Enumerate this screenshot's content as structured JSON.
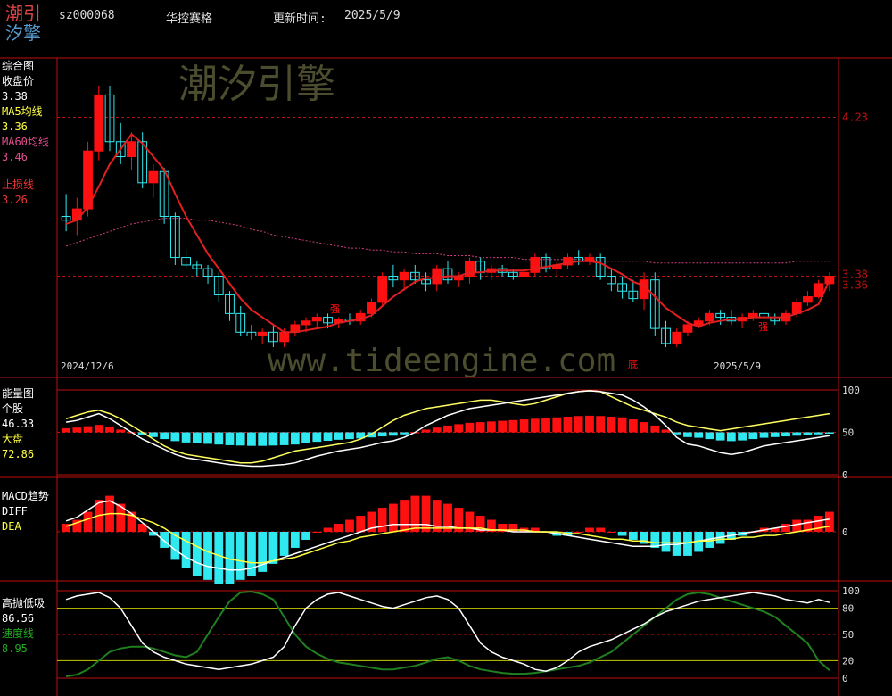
{
  "header": {
    "logo_top": "潮引",
    "logo_bottom": "汐擎",
    "code": "sz000068",
    "name": "华控赛格",
    "update_label": "更新时间:",
    "update_date": "2025/5/9"
  },
  "watermarks": {
    "brand": "潮汐引擎",
    "url": "www.tideengine.com"
  },
  "colors": {
    "up": "#ff1010",
    "down": "#30e8f0",
    "ma5": "#ffff40",
    "ma60": "#d04080",
    "stop": "#e02020",
    "frame": "#c01010",
    "energy_stock": "#ffffff",
    "energy_market": "#ffff60",
    "speed": "#208020"
  },
  "main_panel": {
    "title": "综合图",
    "close_label": "收盘价",
    "close_value": "3.38",
    "ma5_label": "MA5均线",
    "ma5_value": "3.36",
    "ma60_label": "MA60均线",
    "ma60_value": "3.46",
    "stop_label": "止损线",
    "stop_value": "3.26",
    "date_start": "2024/12/6",
    "date_end": "2025/5/9",
    "price_ticks": [
      "4.23",
      "3.38",
      "3.36"
    ],
    "annotations": [
      "强",
      "强",
      "底"
    ]
  },
  "energy_panel": {
    "title": "能量图",
    "stock_label": "个股",
    "stock_value": "46.33",
    "market_label": "大盘",
    "market_value": "72.86",
    "ticks": [
      "100",
      "50",
      "0"
    ]
  },
  "macd_panel": {
    "title": "MACD趋势",
    "diff_label": "DIFF",
    "dea_label": "DEA",
    "ticks": [
      "0"
    ]
  },
  "gaopao_panel": {
    "title": "高抛低吸",
    "value": "86.56",
    "speed_label": "速度线",
    "speed_value": "8.95",
    "ticks": [
      "100",
      "80",
      "50",
      "20",
      "0"
    ]
  },
  "chart_data": {
    "type": "line",
    "title": "华控赛格 sz000068",
    "x_start": "2024/12/6",
    "x_end": "2025/5/9",
    "candles_ohlc": [
      [
        3.7,
        3.82,
        3.62,
        3.68
      ],
      [
        3.68,
        3.8,
        3.6,
        3.74
      ],
      [
        3.74,
        4.1,
        3.7,
        4.05
      ],
      [
        4.05,
        4.4,
        4.0,
        4.35
      ],
      [
        4.35,
        4.4,
        4.05,
        4.1
      ],
      [
        4.1,
        4.2,
        3.98,
        4.02
      ],
      [
        4.02,
        4.15,
        3.95,
        4.1
      ],
      [
        4.1,
        4.15,
        3.85,
        3.88
      ],
      [
        3.88,
        3.98,
        3.8,
        3.94
      ],
      [
        3.94,
        3.96,
        3.66,
        3.7
      ],
      [
        3.7,
        3.72,
        3.44,
        3.48
      ],
      [
        3.48,
        3.52,
        3.42,
        3.44
      ],
      [
        3.44,
        3.46,
        3.38,
        3.42
      ],
      [
        3.42,
        3.44,
        3.34,
        3.38
      ],
      [
        3.38,
        3.4,
        3.24,
        3.28
      ],
      [
        3.28,
        3.3,
        3.14,
        3.18
      ],
      [
        3.18,
        3.22,
        3.06,
        3.08
      ],
      [
        3.08,
        3.12,
        3.04,
        3.06
      ],
      [
        3.06,
        3.1,
        3.02,
        3.08
      ],
      [
        3.08,
        3.12,
        3.0,
        3.03
      ],
      [
        3.03,
        3.1,
        3.0,
        3.08
      ],
      [
        3.08,
        3.14,
        3.06,
        3.12
      ],
      [
        3.12,
        3.16,
        3.08,
        3.14
      ],
      [
        3.14,
        3.18,
        3.1,
        3.16
      ],
      [
        3.16,
        3.18,
        3.1,
        3.13
      ],
      [
        3.13,
        3.16,
        3.1,
        3.15
      ],
      [
        3.15,
        3.18,
        3.12,
        3.14
      ],
      [
        3.14,
        3.2,
        3.12,
        3.18
      ],
      [
        3.18,
        3.26,
        3.16,
        3.24
      ],
      [
        3.24,
        3.4,
        3.22,
        3.38
      ],
      [
        3.38,
        3.44,
        3.32,
        3.36
      ],
      [
        3.36,
        3.42,
        3.3,
        3.4
      ],
      [
        3.4,
        3.44,
        3.34,
        3.36
      ],
      [
        3.36,
        3.4,
        3.3,
        3.34
      ],
      [
        3.34,
        3.44,
        3.3,
        3.42
      ],
      [
        3.42,
        3.46,
        3.34,
        3.36
      ],
      [
        3.36,
        3.4,
        3.32,
        3.38
      ],
      [
        3.38,
        3.48,
        3.34,
        3.46
      ],
      [
        3.46,
        3.48,
        3.36,
        3.4
      ],
      [
        3.4,
        3.44,
        3.36,
        3.42
      ],
      [
        3.42,
        3.44,
        3.38,
        3.4
      ],
      [
        3.4,
        3.42,
        3.36,
        3.38
      ],
      [
        3.38,
        3.42,
        3.36,
        3.4
      ],
      [
        3.4,
        3.5,
        3.38,
        3.48
      ],
      [
        3.48,
        3.5,
        3.4,
        3.42
      ],
      [
        3.42,
        3.46,
        3.38,
        3.44
      ],
      [
        3.44,
        3.5,
        3.42,
        3.48
      ],
      [
        3.48,
        3.52,
        3.44,
        3.46
      ],
      [
        3.46,
        3.5,
        3.44,
        3.48
      ],
      [
        3.48,
        3.5,
        3.36,
        3.38
      ],
      [
        3.38,
        3.42,
        3.3,
        3.34
      ],
      [
        3.34,
        3.38,
        3.26,
        3.3
      ],
      [
        3.3,
        3.36,
        3.24,
        3.26
      ],
      [
        3.26,
        3.4,
        3.2,
        3.36
      ],
      [
        3.36,
        3.4,
        3.06,
        3.1
      ],
      [
        3.1,
        3.14,
        3.0,
        3.02
      ],
      [
        3.02,
        3.1,
        3.0,
        3.08
      ],
      [
        3.08,
        3.14,
        3.06,
        3.12
      ],
      [
        3.12,
        3.16,
        3.1,
        3.14
      ],
      [
        3.14,
        3.2,
        3.12,
        3.18
      ],
      [
        3.18,
        3.2,
        3.12,
        3.16
      ],
      [
        3.16,
        3.2,
        3.12,
        3.14
      ],
      [
        3.14,
        3.18,
        3.1,
        3.16
      ],
      [
        3.16,
        3.2,
        3.14,
        3.18
      ],
      [
        3.18,
        3.2,
        3.14,
        3.16
      ],
      [
        3.16,
        3.18,
        3.12,
        3.14
      ],
      [
        3.14,
        3.2,
        3.12,
        3.18
      ],
      [
        3.18,
        3.26,
        3.16,
        3.24
      ],
      [
        3.24,
        3.3,
        3.22,
        3.27
      ],
      [
        3.27,
        3.36,
        3.26,
        3.34
      ],
      [
        3.34,
        3.4,
        3.3,
        3.38
      ]
    ],
    "ma5": [
      3.66,
      3.68,
      3.75,
      3.86,
      3.98,
      4.06,
      4.14,
      4.09,
      4.02,
      3.95,
      3.82,
      3.7,
      3.6,
      3.5,
      3.42,
      3.34,
      3.26,
      3.2,
      3.16,
      3.12,
      3.08,
      3.08,
      3.09,
      3.1,
      3.11,
      3.13,
      3.14,
      3.15,
      3.17,
      3.22,
      3.27,
      3.31,
      3.35,
      3.37,
      3.37,
      3.38,
      3.38,
      3.4,
      3.4,
      3.41,
      3.41,
      3.41,
      3.41,
      3.42,
      3.43,
      3.44,
      3.45,
      3.46,
      3.46,
      3.45,
      3.42,
      3.39,
      3.35,
      3.33,
      3.27,
      3.21,
      3.17,
      3.13,
      3.11,
      3.13,
      3.14,
      3.15,
      3.15,
      3.16,
      3.16,
      3.16,
      3.16,
      3.18,
      3.2,
      3.23,
      3.36
    ],
    "ma60": [
      3.54,
      3.56,
      3.58,
      3.6,
      3.62,
      3.64,
      3.66,
      3.67,
      3.68,
      3.69,
      3.69,
      3.69,
      3.68,
      3.68,
      3.67,
      3.66,
      3.65,
      3.63,
      3.62,
      3.6,
      3.59,
      3.58,
      3.57,
      3.56,
      3.55,
      3.54,
      3.53,
      3.53,
      3.52,
      3.52,
      3.51,
      3.51,
      3.5,
      3.5,
      3.5,
      3.49,
      3.49,
      3.49,
      3.48,
      3.48,
      3.48,
      3.48,
      3.47,
      3.47,
      3.47,
      3.47,
      3.47,
      3.47,
      3.47,
      3.46,
      3.46,
      3.46,
      3.46,
      3.46,
      3.45,
      3.45,
      3.45,
      3.45,
      3.45,
      3.45,
      3.45,
      3.45,
      3.45,
      3.45,
      3.45,
      3.45,
      3.45,
      3.46,
      3.46,
      3.46,
      3.46
    ],
    "energy_stock": [
      62,
      64,
      68,
      72,
      66,
      58,
      50,
      42,
      36,
      30,
      24,
      20,
      18,
      16,
      14,
      12,
      11,
      10,
      10,
      11,
      12,
      14,
      18,
      22,
      25,
      28,
      30,
      32,
      35,
      38,
      40,
      44,
      50,
      58,
      64,
      70,
      74,
      78,
      80,
      82,
      84,
      86,
      88,
      90,
      92,
      94,
      96,
      98,
      99,
      98,
      96,
      94,
      88,
      80,
      70,
      58,
      44,
      36,
      34,
      30,
      26,
      24,
      26,
      30,
      34,
      36,
      38,
      40,
      42,
      44,
      46
    ],
    "energy_market": [
      66,
      70,
      74,
      76,
      72,
      66,
      58,
      50,
      42,
      34,
      28,
      24,
      22,
      20,
      18,
      16,
      14,
      14,
      16,
      20,
      24,
      28,
      30,
      32,
      34,
      36,
      38,
      42,
      48,
      56,
      64,
      70,
      74,
      78,
      80,
      82,
      84,
      86,
      88,
      88,
      86,
      84,
      82,
      84,
      88,
      92,
      96,
      98,
      99,
      98,
      92,
      86,
      80,
      76,
      72,
      68,
      62,
      58,
      56,
      54,
      52,
      54,
      56,
      58,
      60,
      62,
      64,
      66,
      68,
      70,
      72
    ],
    "macd_hist": [
      0.02,
      0.03,
      0.05,
      0.08,
      0.09,
      0.07,
      0.05,
      0.02,
      -0.01,
      -0.04,
      -0.07,
      -0.09,
      -0.11,
      -0.12,
      -0.13,
      -0.13,
      -0.12,
      -0.11,
      -0.1,
      -0.08,
      -0.06,
      -0.04,
      -0.02,
      0.0,
      0.01,
      0.02,
      0.03,
      0.04,
      0.05,
      0.06,
      0.07,
      0.08,
      0.09,
      0.09,
      0.08,
      0.07,
      0.06,
      0.05,
      0.04,
      0.03,
      0.02,
      0.02,
      0.01,
      0.01,
      0.0,
      -0.01,
      -0.01,
      0.0,
      0.01,
      0.01,
      0.0,
      -0.01,
      -0.02,
      -0.03,
      -0.04,
      -0.05,
      -0.06,
      -0.06,
      -0.05,
      -0.04,
      -0.03,
      -0.02,
      -0.01,
      0.0,
      0.01,
      0.01,
      0.02,
      0.03,
      0.03,
      0.04,
      0.05
    ],
    "macd_diff": [
      0.06,
      0.08,
      0.12,
      0.16,
      0.17,
      0.14,
      0.1,
      0.05,
      0.0,
      -0.05,
      -0.1,
      -0.14,
      -0.17,
      -0.19,
      -0.2,
      -0.21,
      -0.21,
      -0.2,
      -0.18,
      -0.16,
      -0.14,
      -0.12,
      -0.1,
      -0.08,
      -0.06,
      -0.04,
      -0.02,
      0.0,
      0.02,
      0.03,
      0.04,
      0.04,
      0.04,
      0.04,
      0.03,
      0.03,
      0.02,
      0.02,
      0.01,
      0.01,
      0.01,
      0.0,
      0.0,
      0.0,
      0.0,
      -0.01,
      -0.02,
      -0.03,
      -0.04,
      -0.05,
      -0.06,
      -0.07,
      -0.08,
      -0.08,
      -0.08,
      -0.07,
      -0.07,
      -0.06,
      -0.05,
      -0.04,
      -0.03,
      -0.02,
      -0.01,
      0.0,
      0.01,
      0.02,
      0.03,
      0.04,
      0.05,
      0.06,
      0.07
    ],
    "macd_dea": [
      0.03,
      0.05,
      0.07,
      0.09,
      0.1,
      0.1,
      0.09,
      0.07,
      0.05,
      0.02,
      -0.02,
      -0.05,
      -0.08,
      -0.11,
      -0.13,
      -0.15,
      -0.16,
      -0.17,
      -0.17,
      -0.16,
      -0.15,
      -0.14,
      -0.12,
      -0.1,
      -0.08,
      -0.06,
      -0.05,
      -0.03,
      -0.02,
      -0.01,
      0.0,
      0.01,
      0.02,
      0.02,
      0.02,
      0.02,
      0.02,
      0.02,
      0.02,
      0.01,
      0.01,
      0.01,
      0.01,
      0.0,
      0.0,
      0.0,
      -0.01,
      -0.01,
      -0.02,
      -0.03,
      -0.04,
      -0.04,
      -0.05,
      -0.05,
      -0.06,
      -0.06,
      -0.06,
      -0.06,
      -0.05,
      -0.05,
      -0.04,
      -0.04,
      -0.03,
      -0.03,
      -0.02,
      -0.02,
      -0.01,
      0.0,
      0.01,
      0.02,
      0.03
    ],
    "gaopao": [
      90,
      94,
      96,
      98,
      92,
      80,
      60,
      40,
      30,
      24,
      20,
      16,
      14,
      12,
      10,
      12,
      14,
      16,
      20,
      24,
      36,
      60,
      80,
      90,
      96,
      98,
      94,
      90,
      86,
      82,
      80,
      84,
      88,
      92,
      94,
      90,
      80,
      60,
      40,
      30,
      24,
      20,
      16,
      10,
      8,
      12,
      20,
      30,
      36,
      40,
      44,
      50,
      56,
      62,
      70,
      76,
      80,
      84,
      88,
      90,
      92,
      94,
      96,
      98,
      96,
      94,
      90,
      88,
      86,
      90,
      86.56
    ],
    "speed": [
      2,
      4,
      10,
      20,
      30,
      34,
      36,
      36,
      34,
      30,
      26,
      24,
      30,
      50,
      70,
      88,
      98,
      99,
      96,
      90,
      70,
      50,
      36,
      28,
      22,
      18,
      16,
      14,
      12,
      10,
      10,
      12,
      14,
      18,
      22,
      24,
      20,
      14,
      10,
      8,
      6,
      5,
      5,
      6,
      8,
      10,
      12,
      14,
      18,
      24,
      30,
      40,
      50,
      60,
      70,
      80,
      90,
      96,
      98,
      96,
      92,
      88,
      84,
      80,
      76,
      70,
      60,
      50,
      40,
      20,
      8.95
    ]
  }
}
